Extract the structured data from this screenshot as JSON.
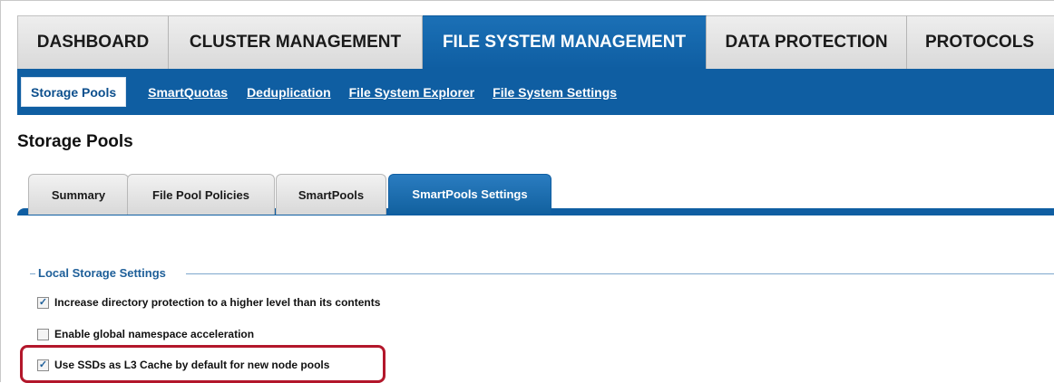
{
  "main_nav": [
    {
      "label": "DASHBOARD"
    },
    {
      "label": "CLUSTER MANAGEMENT"
    },
    {
      "label": "FILE SYSTEM MANAGEMENT"
    },
    {
      "label": "DATA PROTECTION"
    },
    {
      "label": "PROTOCOLS"
    }
  ],
  "sub_nav": [
    {
      "label": "Storage Pools"
    },
    {
      "label": "SmartQuotas"
    },
    {
      "label": "Deduplication"
    },
    {
      "label": "File System Explorer"
    },
    {
      "label": "File System Settings"
    }
  ],
  "page": {
    "title": "Storage Pools"
  },
  "tabs": [
    {
      "label": "Summary"
    },
    {
      "label": "File Pool Policies"
    },
    {
      "label": "SmartPools"
    },
    {
      "label": "SmartPools Settings"
    }
  ],
  "section": {
    "legend": "Local Storage Settings",
    "options": [
      {
        "label": "Increase directory protection to a higher level than its contents",
        "checked": true,
        "mark": "✓"
      },
      {
        "label": "Enable global namespace acceleration",
        "checked": false,
        "mark": ""
      },
      {
        "label": "Use SSDs as L3 Cache by default for new node pools",
        "checked": true,
        "mark": "✓"
      }
    ]
  },
  "colors": {
    "brand_blue": "#0f5ea2",
    "highlight_red": "#b3172b"
  }
}
